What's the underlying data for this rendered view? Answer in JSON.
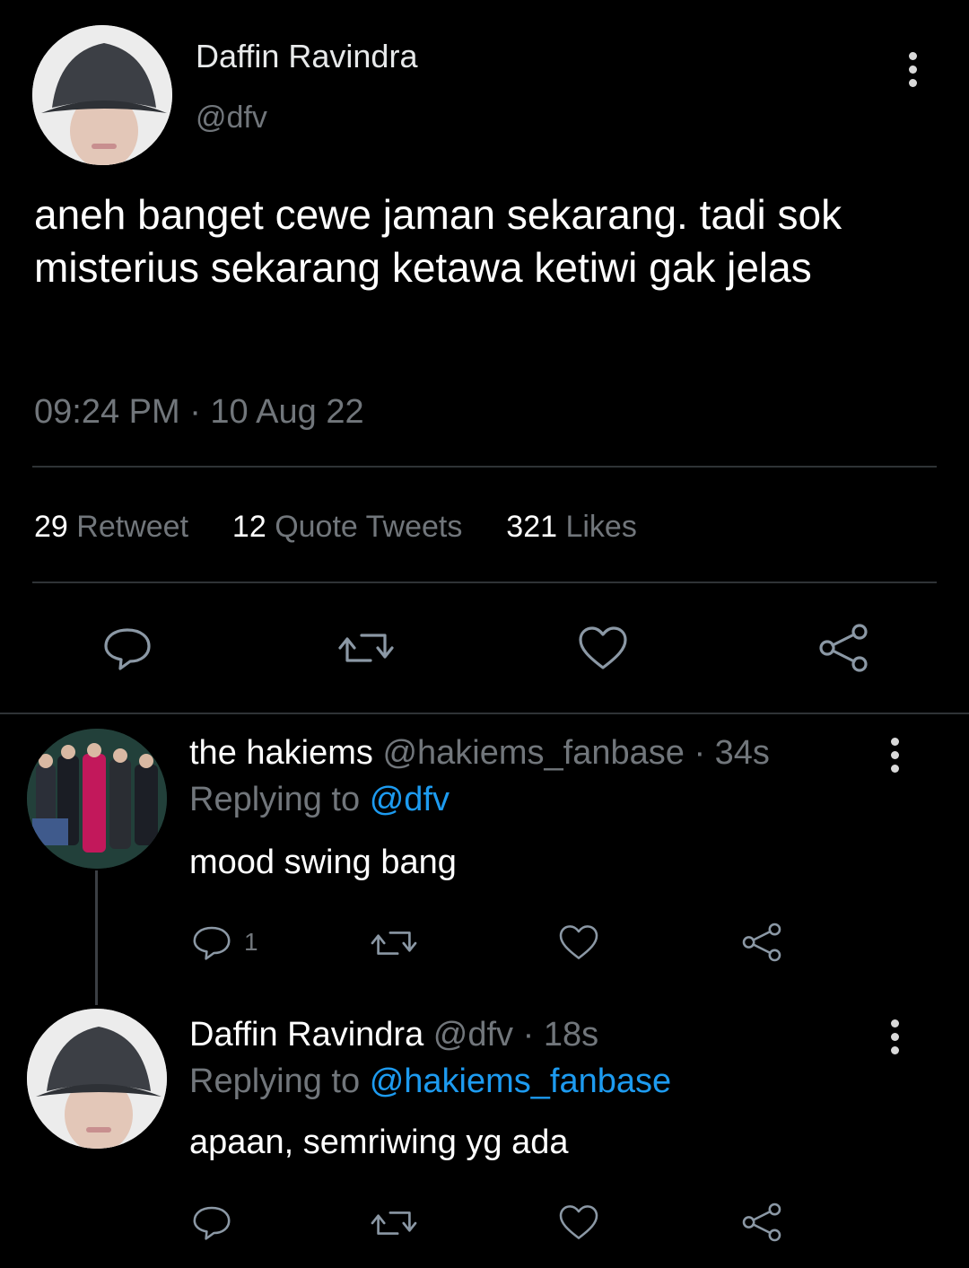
{
  "main_tweet": {
    "author_name": "Daffin Ravindra",
    "author_handle": "@dfv",
    "text": "aneh banget cewe jaman sekarang. tadi sok misterius sekarang ketawa ketiwi gak jelas",
    "timestamp": "09:24 PM · 10 Aug 22",
    "stats": {
      "retweet_count": "29",
      "retweet_label": "Retweet",
      "quote_count": "12",
      "quote_label": "Quote Tweets",
      "likes_count": "321",
      "likes_label": "Likes"
    }
  },
  "replies": [
    {
      "author_name": "the hakiems",
      "author_handle": "@hakiems_fanbase",
      "time": "· 34s",
      "replying_label": "Replying to",
      "replying_to": "@dfv",
      "text": "mood swing bang",
      "reply_count": "1"
    },
    {
      "author_name": "Daffin Ravindra",
      "author_handle": "@dfv",
      "time": "· 18s",
      "replying_label": "Replying to",
      "replying_to": "@hakiems_fanbase",
      "text": "apaan, semriwing yg ada",
      "reply_count": ""
    }
  ],
  "icons": [
    "more-icon",
    "reply-icon",
    "retweet-icon",
    "like-icon",
    "share-icon"
  ],
  "colors": {
    "background": "#000000",
    "text": "#e7e9ea",
    "muted": "#71767b",
    "link": "#1d9bf0",
    "divider": "#2f3336"
  }
}
